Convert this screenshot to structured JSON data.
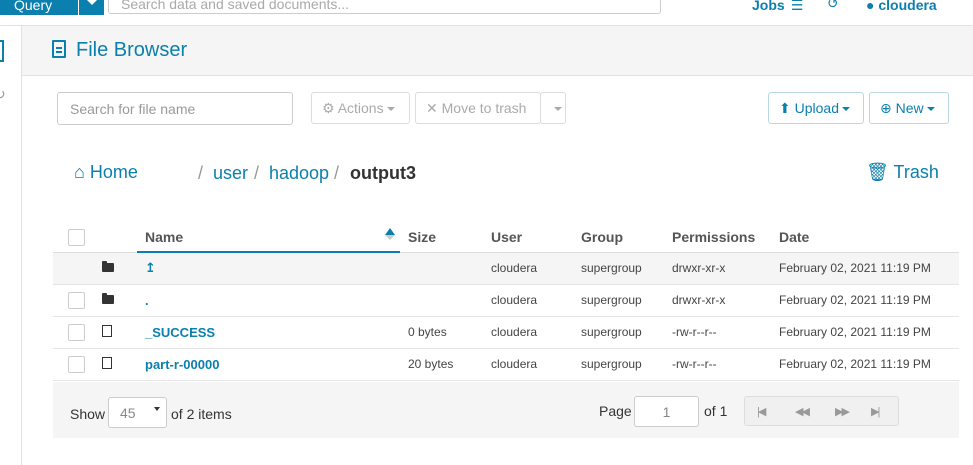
{
  "topbar": {
    "query_label": "Query",
    "search_placeholder": "Search data and saved documents...",
    "jobs_label": "Jobs",
    "user_label": "cloudera"
  },
  "header": {
    "title": "File Browser"
  },
  "toolbar": {
    "search_placeholder": "Search for file name",
    "actions_label": "Actions",
    "move_to_trash_label": "Move to trash",
    "upload_label": "Upload",
    "new_label": "New"
  },
  "breadcrumb": {
    "home_label": "Home",
    "parts": [
      "user",
      "hadoop",
      "output3"
    ],
    "sep": "/",
    "trash_label": "Trash"
  },
  "table": {
    "columns": [
      "Name",
      "Size",
      "User",
      "Group",
      "Permissions",
      "Date"
    ],
    "rows": [
      {
        "name": "↥",
        "size": "",
        "user": "cloudera",
        "group": "supergroup",
        "permissions": "drwxr-xr-x",
        "date": "February 02, 2021 11:19 PM",
        "type": "folder"
      },
      {
        "name": ".",
        "size": "",
        "user": "cloudera",
        "group": "supergroup",
        "permissions": "drwxr-xr-x",
        "date": "February 02, 2021 11:19 PM",
        "type": "folder"
      },
      {
        "name": "_SUCCESS",
        "size": "0 bytes",
        "user": "cloudera",
        "group": "supergroup",
        "permissions": "-rw-r--r--",
        "date": "February 02, 2021 11:19 PM",
        "type": "file"
      },
      {
        "name": "part-r-00000",
        "size": "20 bytes",
        "user": "cloudera",
        "group": "supergroup",
        "permissions": "-rw-r--r--",
        "date": "February 02, 2021 11:19 PM",
        "type": "file"
      }
    ]
  },
  "footer": {
    "show_label": "Show",
    "page_size": "45",
    "of_items": "of 2 items",
    "page_label": "Page",
    "page_value": "1",
    "page_of": "of 1"
  },
  "colors": {
    "accent": "#0b7fad"
  }
}
